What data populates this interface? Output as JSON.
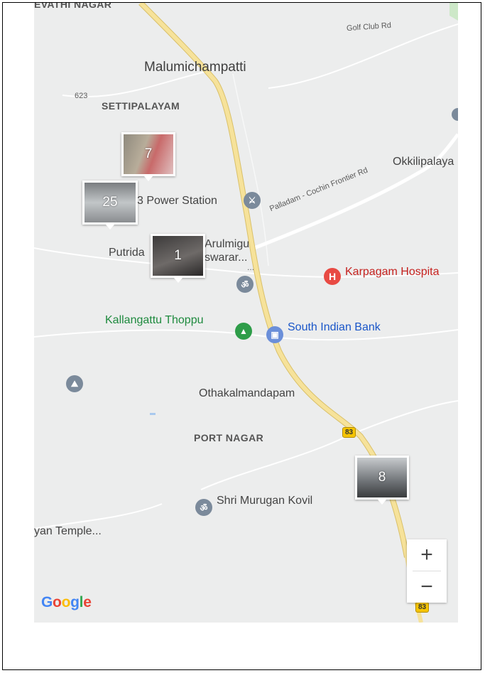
{
  "map": {
    "areas": {
      "revathi_nagar": "EVATHI NAGAR",
      "settipalayam": "SETTIPALAYAM",
      "port_nagar": "PORT NAGAR"
    },
    "places": {
      "malumichampatti": "Malumichampatti",
      "okkilipalaya": "Okkilipalaya",
      "othakalmandapam": "Othakalmandapam"
    },
    "roads": {
      "golf_club": "Golf Club Rd",
      "palladam": "Palladam - Cochin Frontier Rd",
      "route_623": "623",
      "shield_83_a": "83",
      "shield_83_b": "83",
      "route_83_vertical": "83"
    },
    "pois": {
      "power_station": "3 Power Station",
      "arulmigu": "Arulmigu",
      "eswarar": "swarar...",
      "dots": "...",
      "putrida": "Putrida",
      "karpagam": "Karpagam Hospita",
      "kallangattu": "Kallangattu Thoppu",
      "south_indian_bank": "South Indian Bank",
      "shri_murugan": "Shri Murugan Kovil",
      "temple": "yan Temple..."
    },
    "photo_clusters": [
      {
        "count": "7"
      },
      {
        "count": "25"
      },
      {
        "count": "1"
      },
      {
        "count": "8"
      }
    ],
    "zoom": {
      "in": "+",
      "out": "−"
    },
    "logo": {
      "G": "G",
      "o1": "o",
      "o2": "o",
      "g": "g",
      "l": "l",
      "e": "e"
    },
    "colors": {
      "map_bg": "#eceded",
      "highway": "#f6e29a",
      "poi_green": "#1e8a3e",
      "poi_red": "#c5221f",
      "poi_blue": "#1a56c9"
    }
  }
}
